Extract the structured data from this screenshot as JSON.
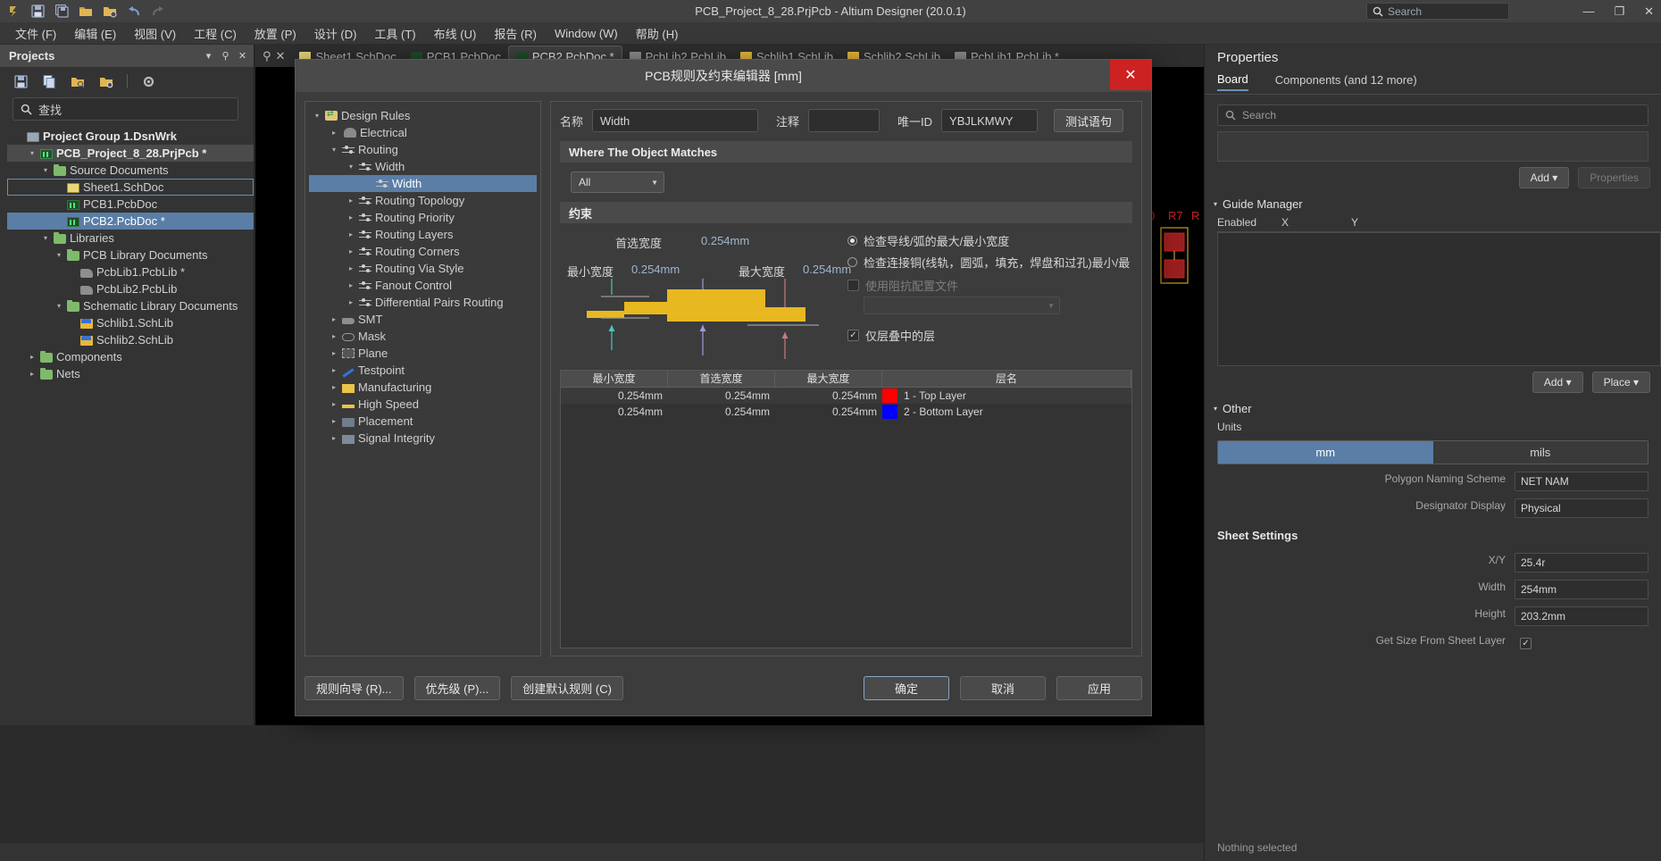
{
  "window": {
    "title": "PCB_Project_8_28.PrjPcb - Altium Designer (20.0.1)",
    "search_placeholder": "Search",
    "minimize": "—",
    "restore": "❐",
    "close": "✕"
  },
  "quick_toolbar": [
    {
      "name": "altium-logo-icon",
      "glyph": "∂"
    },
    {
      "name": "save-icon",
      "glyph": "▤"
    },
    {
      "name": "save-all-icon",
      "glyph": "▥"
    },
    {
      "name": "open-folder-icon",
      "glyph": "📂"
    },
    {
      "name": "open-project-icon",
      "glyph": "📁"
    },
    {
      "name": "undo-icon",
      "glyph": "↶"
    },
    {
      "name": "redo-icon",
      "glyph": "↷"
    }
  ],
  "menubar": [
    {
      "label": "文件 (F)",
      "name": "menu-file"
    },
    {
      "label": "编辑 (E)",
      "name": "menu-edit"
    },
    {
      "label": "视图 (V)",
      "name": "menu-view"
    },
    {
      "label": "工程 (C)",
      "name": "menu-project"
    },
    {
      "label": "放置 (P)",
      "name": "menu-place"
    },
    {
      "label": "设计 (D)",
      "name": "menu-design"
    },
    {
      "label": "工具 (T)",
      "name": "menu-tools"
    },
    {
      "label": "布线 (U)",
      "name": "menu-route"
    },
    {
      "label": "报告 (R)",
      "name": "menu-reports"
    },
    {
      "label": "Window (W)",
      "name": "menu-window"
    },
    {
      "label": "帮助 (H)",
      "name": "menu-help"
    }
  ],
  "projects_panel": {
    "title": "Projects",
    "search_placeholder": "查找",
    "toolbar": [
      {
        "name": "save-icon",
        "glyph": "▤"
      },
      {
        "name": "copy-icon",
        "glyph": "▣"
      },
      {
        "name": "open-search-folder-icon",
        "glyph": "📂"
      },
      {
        "name": "open-settings-folder-icon",
        "glyph": "📁"
      },
      {
        "name": "gear-icon",
        "glyph": "⚙"
      }
    ],
    "tree": [
      {
        "label": "Project Group 1.DsnWrk",
        "indent": 0,
        "arrow": "",
        "icon": "ic-wrk",
        "bold": true,
        "state": ""
      },
      {
        "label": "PCB_Project_8_28.PrjPcb *",
        "indent": 1,
        "arrow": "▾",
        "icon": "ic-prj",
        "bold": true,
        "state": "hl"
      },
      {
        "label": "Source Documents",
        "indent": 2,
        "arrow": "▾",
        "icon": "ic-folder",
        "bold": false,
        "state": ""
      },
      {
        "label": "Sheet1.SchDoc",
        "indent": 3,
        "arrow": "",
        "icon": "ic-sch",
        "bold": false,
        "state": "outline"
      },
      {
        "label": "PCB1.PcbDoc",
        "indent": 3,
        "arrow": "",
        "icon": "ic-pcb",
        "bold": false,
        "state": ""
      },
      {
        "label": "PCB2.PcbDoc *",
        "indent": 3,
        "arrow": "",
        "icon": "ic-pcb",
        "bold": false,
        "state": "sel"
      },
      {
        "label": "Libraries",
        "indent": 2,
        "arrow": "▾",
        "icon": "ic-folder",
        "bold": false,
        "state": ""
      },
      {
        "label": "PCB Library Documents",
        "indent": 3,
        "arrow": "▾",
        "icon": "ic-folder",
        "bold": false,
        "state": ""
      },
      {
        "label": "PcbLib1.PcbLib *",
        "indent": 4,
        "arrow": "",
        "icon": "ic-lib",
        "bold": false,
        "state": ""
      },
      {
        "label": "PcbLib2.PcbLib",
        "indent": 4,
        "arrow": "",
        "icon": "ic-lib",
        "bold": false,
        "state": ""
      },
      {
        "label": "Schematic Library Documents",
        "indent": 3,
        "arrow": "▾",
        "icon": "ic-folder",
        "bold": false,
        "state": ""
      },
      {
        "label": "Schlib1.SchLib",
        "indent": 4,
        "arrow": "",
        "icon": "ic-schlib",
        "bold": false,
        "state": ""
      },
      {
        "label": "Schlib2.SchLib",
        "indent": 4,
        "arrow": "",
        "icon": "ic-schlib",
        "bold": false,
        "state": ""
      },
      {
        "label": "Components",
        "indent": 1,
        "arrow": "▸",
        "icon": "ic-folder",
        "bold": false,
        "state": ""
      },
      {
        "label": "Nets",
        "indent": 1,
        "arrow": "▸",
        "icon": "ic-folder",
        "bold": false,
        "state": ""
      }
    ]
  },
  "document_tabs": [
    {
      "label": "Sheet1.SchDoc",
      "active": false,
      "color": "#e8d77a"
    },
    {
      "label": "PCB1.PcbDoc",
      "active": false,
      "color": "#1f4d2b"
    },
    {
      "label": "PCB2.PcbDoc *",
      "active": true,
      "color": "#1f4d2b"
    },
    {
      "label": "PcbLib2.PcbLib",
      "active": false,
      "color": "#8e8e8e"
    },
    {
      "label": "Schlib1.SchLib",
      "active": false,
      "color": "#e8b93a"
    },
    {
      "label": "Schlib2.SchLib",
      "active": false,
      "color": "#e8b93a"
    },
    {
      "label": "PcbLib1.PcbLib *",
      "active": false,
      "color": "#8e8e8e"
    }
  ],
  "dialog": {
    "title": "PCB规则及约束编辑器 [mm]",
    "close_glyph": "✕",
    "name_label": "名称",
    "name_value": "Width",
    "comment_label": "注释",
    "comment_value": "",
    "uniqueid_label": "唯一ID",
    "uniqueid_value": "YBJLKMWY",
    "test_button": "测试语句",
    "where_band": "Where The Object Matches",
    "scope_value": "All",
    "constraint_band": "约束",
    "pref_width_label": "首选宽度",
    "pref_width_value": "0.254mm",
    "min_width_label": "最小宽度",
    "min_width_value": "0.254mm",
    "max_width_label": "最大宽度",
    "max_width_value": "0.254mm",
    "radio_option_1": "检查导线/弧的最大/最小宽度",
    "radio_option_2": "检查连接铜(线轨，圆弧，填充，焊盘和过孔)最小/最",
    "impedance_label": "使用阻抗配置文件",
    "impedance_value": "",
    "layers_checkbox_label": "仅层叠中的层",
    "layers_checkbox_checked": true,
    "table": {
      "columns": [
        "最小宽度",
        "首选宽度",
        "最大宽度",
        "层名"
      ],
      "rows": [
        {
          "min": "0.254mm",
          "pref": "0.254mm",
          "max": "0.254mm",
          "color": "#ff0000",
          "layer": "1 - Top Layer"
        },
        {
          "min": "0.254mm",
          "pref": "0.254mm",
          "max": "0.254mm",
          "color": "#0000ff",
          "layer": "2 - Bottom Layer"
        }
      ]
    },
    "footer_buttons": [
      {
        "label": "规则向导 (R)...",
        "name": "rule-wizard-button",
        "primary": false
      },
      {
        "label": "优先级 (P)...",
        "name": "priority-button",
        "primary": false
      },
      {
        "label": "创建默认规则 (C)",
        "name": "create-default-rules-button",
        "primary": false
      }
    ],
    "footer_right_buttons": [
      {
        "label": "确定",
        "name": "ok-button",
        "primary": true
      },
      {
        "label": "取消",
        "name": "cancel-button",
        "primary": false
      },
      {
        "label": "应用",
        "name": "apply-button",
        "primary": false
      }
    ],
    "rule_tree": [
      {
        "label": "Design Rules",
        "indent": 0,
        "arrow": "▾",
        "icon": "ri-dr",
        "sel": false
      },
      {
        "label": "Electrical",
        "indent": 1,
        "arrow": "▸",
        "icon": "ri-elec",
        "sel": false
      },
      {
        "label": "Routing",
        "indent": 1,
        "arrow": "▾",
        "icon": "ri-route",
        "sel": false
      },
      {
        "label": "Width",
        "indent": 2,
        "arrow": "▾",
        "icon": "ri-route",
        "sel": false
      },
      {
        "label": "Width",
        "indent": 3,
        "arrow": "",
        "icon": "ri-route",
        "sel": true
      },
      {
        "label": "Routing Topology",
        "indent": 2,
        "arrow": "▸",
        "icon": "ri-route",
        "sel": false
      },
      {
        "label": "Routing Priority",
        "indent": 2,
        "arrow": "▸",
        "icon": "ri-route",
        "sel": false
      },
      {
        "label": "Routing Layers",
        "indent": 2,
        "arrow": "▸",
        "icon": "ri-route",
        "sel": false
      },
      {
        "label": "Routing Corners",
        "indent": 2,
        "arrow": "▸",
        "icon": "ri-route",
        "sel": false
      },
      {
        "label": "Routing Via Style",
        "indent": 2,
        "arrow": "▸",
        "icon": "ri-route",
        "sel": false
      },
      {
        "label": "Fanout Control",
        "indent": 2,
        "arrow": "▸",
        "icon": "ri-route",
        "sel": false
      },
      {
        "label": "Differential Pairs Routing",
        "indent": 2,
        "arrow": "▸",
        "icon": "ri-route",
        "sel": false
      },
      {
        "label": "SMT",
        "indent": 1,
        "arrow": "▸",
        "icon": "ri-smt",
        "sel": false
      },
      {
        "label": "Mask",
        "indent": 1,
        "arrow": "▸",
        "icon": "ri-mask",
        "sel": false
      },
      {
        "label": "Plane",
        "indent": 1,
        "arrow": "▸",
        "icon": "ri-plane",
        "sel": false
      },
      {
        "label": "Testpoint",
        "indent": 1,
        "arrow": "▸",
        "icon": "ri-test",
        "sel": false
      },
      {
        "label": "Manufacturing",
        "indent": 1,
        "arrow": "▸",
        "icon": "ri-manu",
        "sel": false
      },
      {
        "label": "High Speed",
        "indent": 1,
        "arrow": "▸",
        "icon": "ri-hs",
        "sel": false
      },
      {
        "label": "Placement",
        "indent": 1,
        "arrow": "▸",
        "icon": "ri-place",
        "sel": false
      },
      {
        "label": "Signal Integrity",
        "indent": 1,
        "arrow": "▸",
        "icon": "ri-si",
        "sel": false
      }
    ]
  },
  "properties_panel": {
    "title": "Properties",
    "tabs": [
      {
        "label": "Board",
        "active": true
      },
      {
        "label": "Components (and 12 more)",
        "active": false
      }
    ],
    "search_placeholder": "Search",
    "add_button": "Add",
    "properties_button": "Properties",
    "guide_manager_title": "Guide Manager",
    "guide_columns": [
      "Enabled",
      "X",
      "Y"
    ],
    "guide_add_button": "Add",
    "guide_place_button": "Place",
    "other_title": "Other",
    "units_label": "Units",
    "units_mm": "mm",
    "units_mils": "mils",
    "polygon_naming_label": "Polygon Naming Scheme",
    "polygon_naming_value": "NET NAM",
    "designator_label": "Designator Display",
    "designator_value": "Physical",
    "sheet_settings_title": "Sheet Settings",
    "xy_label": "X/Y",
    "xy_value": "25.4r",
    "width_label": "Width",
    "width_value": "254mm",
    "height_label": "Height",
    "height_value": "203.2mm",
    "get_size_label": "Get Size From Sheet Layer",
    "get_size_checked": true,
    "status": "Nothing selected"
  }
}
